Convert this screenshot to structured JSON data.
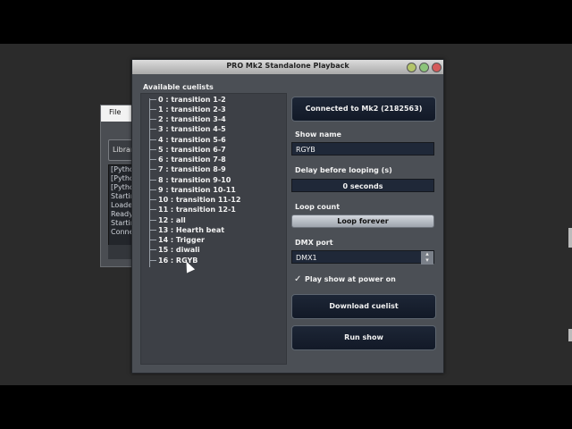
{
  "background_window": {
    "menu_file": "File",
    "library_label": "Librar",
    "log_lines": [
      "[Pytho",
      "[Pytho",
      "[Pytho",
      "Startin",
      "Loade",
      "Ready",
      "Startin",
      "Conne"
    ]
  },
  "window": {
    "title": "PRO Mk2 Standalone Playback"
  },
  "cuelists": {
    "heading": "Available cuelists",
    "items": [
      "0 : transition 1-2",
      "1 : transition 2-3",
      "2 : transition 3-4",
      "3 : transition 4-5",
      "4 : transition 5-6",
      "5 : transition 6-7",
      "6 : transition 7-8",
      "7 : transition 8-9",
      "8 : transition 9-10",
      "9 : transition 10-11",
      "10 : transition 11-12",
      "11 : transition 12-1",
      "12 : all",
      "13 : Hearth beat",
      "14 : Trigger",
      "15 : diwali",
      "16 : RGYB"
    ]
  },
  "controls": {
    "connected_button": "Connected to Mk2 (2182563)",
    "show_name_label": "Show name",
    "show_name_value": "RGYB",
    "delay_label": "Delay before looping (s)",
    "delay_value": "0 seconds",
    "loop_count_label": "Loop count",
    "loop_count_value": "Loop forever",
    "dmx_port_label": "DMX port",
    "dmx_port_value": "DMX1",
    "play_at_power_on_label": "Play show at power on",
    "play_at_power_on_checked": true,
    "download_button": "Download cuelist",
    "run_button": "Run show"
  }
}
